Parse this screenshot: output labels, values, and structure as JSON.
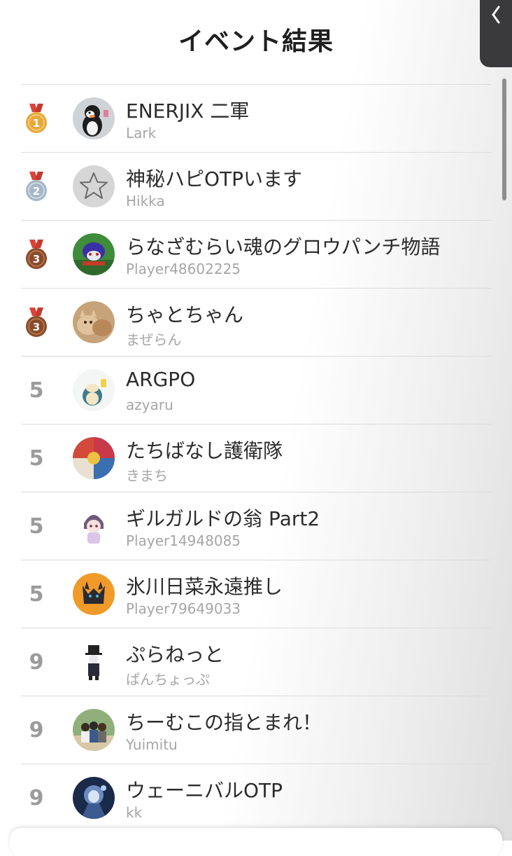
{
  "header": {
    "title": "イベント結果",
    "close_icon": "chevron-left-icon"
  },
  "colors": {
    "gold": "#e7a93b",
    "silver": "#a6b7c7",
    "bronze": "#8a4b2a",
    "ribbon": "#d9453a",
    "rank_text": "#9b9b9b"
  },
  "results": [
    {
      "rank": "1",
      "medal": "gold",
      "name": "ENERJIX 二軍",
      "user": "Lark",
      "avatar": "penguin-avatar"
    },
    {
      "rank": "2",
      "medal": "silver",
      "name": "神秘ハピOTPいます",
      "user": "Hikka",
      "avatar": "star-placeholder-avatar"
    },
    {
      "rank": "3",
      "medal": "bronze",
      "name": "らなざむらい魂のグロウパンチ物語",
      "user": "Player48602225",
      "avatar": "pixel-character-avatar"
    },
    {
      "rank": "3",
      "medal": "bronze",
      "name": "ちゃとちゃん",
      "user": "まぜらん",
      "avatar": "cat-avatar"
    },
    {
      "rank": "5",
      "medal": "",
      "name": "ARGPO",
      "user": "azyaru",
      "avatar": "snorlax-avatar"
    },
    {
      "rank": "5",
      "medal": "",
      "name": "たちばなし護衛隊",
      "user": "きまち",
      "avatar": "collage-avatar"
    },
    {
      "rank": "5",
      "medal": "",
      "name": "ギルガルドの翁 Part2",
      "user": "Player14948085",
      "avatar": "chibi-avatar"
    },
    {
      "rank": "5",
      "medal": "",
      "name": "氷川日菜永遠推し",
      "user": "Player79649033",
      "avatar": "zorua-avatar"
    },
    {
      "rank": "9",
      "medal": "",
      "name": "ぷらねっと",
      "user": "ぱんちょっぷ",
      "avatar": "top-hat-avatar"
    },
    {
      "rank": "9",
      "medal": "",
      "name": "ちーむこの指とまれ！",
      "user": "Yuimitu",
      "avatar": "group-avatar"
    },
    {
      "rank": "9",
      "medal": "",
      "name": "ウェーニバルOTP",
      "user": "kk",
      "avatar": "knight-avatar"
    }
  ]
}
